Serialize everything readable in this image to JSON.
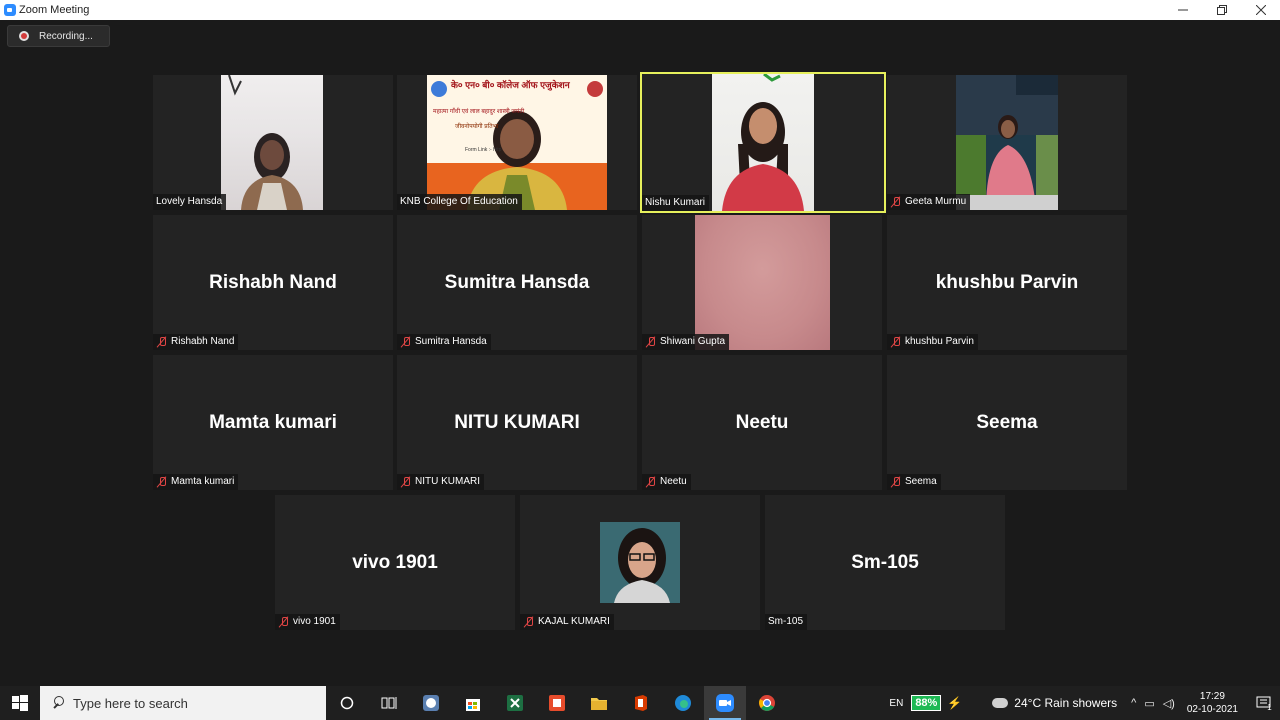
{
  "window": {
    "title": "Zoom Meeting",
    "minimize_icon": "minimize-icon",
    "maximize_icon": "restore-icon",
    "close_icon": "close-icon"
  },
  "recording": {
    "label": "Recording...",
    "icon": "record-icon"
  },
  "tiles": [
    {
      "name": "Lovely Hansda",
      "video": true,
      "muted": false,
      "active": false,
      "big_name": ""
    },
    {
      "name": "KNB College Of Education",
      "video": true,
      "muted": false,
      "active": false,
      "big_name": ""
    },
    {
      "name": "Nishu Kumari",
      "video": true,
      "muted": false,
      "active": true,
      "big_name": ""
    },
    {
      "name": "Geeta Murmu",
      "video": true,
      "muted": true,
      "active": false,
      "big_name": ""
    },
    {
      "name": "Rishabh Nand",
      "video": false,
      "muted": true,
      "active": false,
      "big_name": "Rishabh Nand"
    },
    {
      "name": "Sumitra Hansda",
      "video": false,
      "muted": true,
      "active": false,
      "big_name": "Sumitra Hansda"
    },
    {
      "name": "Shiwani Gupta",
      "video": true,
      "muted": true,
      "active": false,
      "big_name": ""
    },
    {
      "name": "khushbu Parvin",
      "video": false,
      "muted": true,
      "active": false,
      "big_name": "khushbu Parvin"
    },
    {
      "name": "Mamta kumari",
      "video": false,
      "muted": true,
      "active": false,
      "big_name": "Mamta kumari"
    },
    {
      "name": "NITU KUMARI",
      "video": false,
      "muted": true,
      "active": false,
      "big_name": "NITU KUMARI"
    },
    {
      "name": "Neetu",
      "video": false,
      "muted": true,
      "active": false,
      "big_name": "Neetu"
    },
    {
      "name": "Seema",
      "video": false,
      "muted": true,
      "active": false,
      "big_name": "Seema"
    },
    {
      "name": "vivo 1901",
      "video": false,
      "muted": true,
      "active": false,
      "big_name": "vivo 1901"
    },
    {
      "name": "KAJAL KUMARI",
      "video": true,
      "muted": true,
      "active": false,
      "big_name": ""
    },
    {
      "name": "Sm-105",
      "video": false,
      "muted": false,
      "active": false,
      "big_name": "Sm-105"
    }
  ],
  "banner": {
    "line1": "के० एन० बी० कॉलेज ऑफ एजुकेशन",
    "line2": "महात्मा गाँधी एवं लाल बहादुर शास्त्री जयंती",
    "line3": "जीवनोपयोगी प्रतिभा",
    "line4": "Form Link :- http"
  },
  "taskbar": {
    "search_placeholder": "Type here to search",
    "apps": [
      "start-icon",
      "cortana-icon",
      "task-view-icon",
      "app-icon",
      "store-icon",
      "excel-icon",
      "office-icon",
      "file-explorer-icon",
      "office-red-icon",
      "edge-icon",
      "zoom-icon",
      "chrome-icon"
    ],
    "language": "EN",
    "battery": "88%",
    "weather": "24°C  Rain showers",
    "time": "17:29",
    "date": "02-10-2021",
    "notification_count": "1"
  },
  "colors": {
    "active_border": "#e6f05c",
    "tile_bg": "#232323",
    "mute_red": "#e04545",
    "zoom_blue": "#2d8cff"
  }
}
